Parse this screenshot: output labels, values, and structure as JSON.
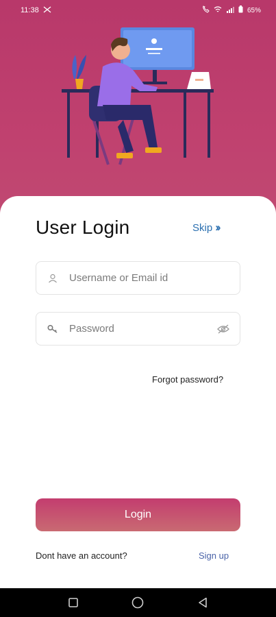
{
  "status_bar": {
    "time": "11:38",
    "battery": "65%"
  },
  "colors": {
    "hero": "#c0416f",
    "accent_link": "#2a6fb0",
    "signup_link": "#4a63a8",
    "button_gradient": [
      "#c33d6f",
      "#c96a72"
    ]
  },
  "login": {
    "title": "User Login",
    "skip_label": "Skip",
    "skip_icon": "double-chevron-right-icon",
    "username_placeholder": "Username or Email id",
    "username_icon": "user-icon",
    "password_placeholder": "Password",
    "password_icon": "key-icon",
    "password_toggle_icon": "eye-off-icon",
    "forgot_label": "Forgot password?",
    "login_button": "Login",
    "no_account_text": "Dont have an account?",
    "signup_label": "Sign up"
  },
  "nav_bar": {
    "icons": [
      "recents-square-icon",
      "home-circle-icon",
      "back-triangle-icon"
    ]
  }
}
